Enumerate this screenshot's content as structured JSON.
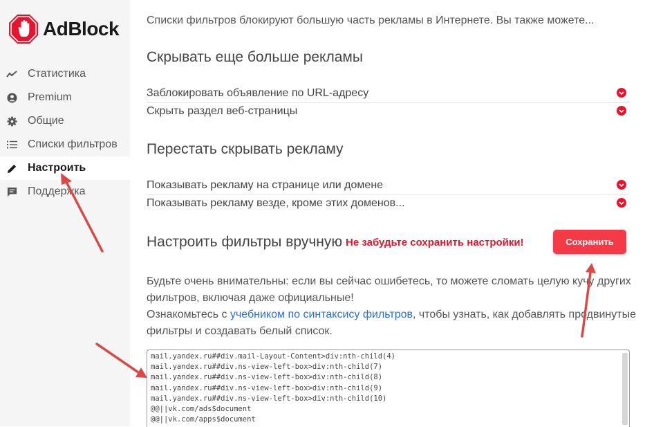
{
  "app": {
    "name": "AdBlock"
  },
  "sidebar": {
    "items": [
      {
        "label": "Статистика",
        "icon": "trend-line-icon",
        "active": false
      },
      {
        "label": "Premium",
        "icon": "user-circle-icon",
        "active": false
      },
      {
        "label": "Общие",
        "icon": "gear-icon",
        "active": false
      },
      {
        "label": "Списки фильтров",
        "icon": "list-icon",
        "active": false
      },
      {
        "label": "Настроить",
        "icon": "pencil-icon",
        "active": true
      },
      {
        "label": "Поддержка",
        "icon": "chat-icon",
        "active": false
      }
    ]
  },
  "main": {
    "intro": "Списки фильтров блокируют большую часть рекламы в Интернете. Вы также можете...",
    "section_hide": {
      "title": "Скрывать еще больше рекламы",
      "rows": [
        "Заблокировать объявление по URL-адресу",
        "Скрыть раздел веб-страницы"
      ]
    },
    "section_show": {
      "title": "Перестать скрывать рекламу",
      "rows": [
        "Показывать рекламу на странице или домене",
        "Показывать рекламу везде, кроме этих доменов..."
      ]
    },
    "manual": {
      "title": "Настроить фильтры вручную",
      "warning": "Не забудьте сохранить настройки!",
      "save_label": "Сохранить",
      "para1_line1": "Будьте очень внимательны: если вы сейчас ошибетесь, то можете сломать целую кучу других",
      "para1_line2": "фильтров, включая даже официальные!",
      "para2_prefix": "Ознакомьтесь с ",
      "para2_link": "учебником по синтаксису фильтров",
      "para2_suffix": ", чтобы узнать, как добавлять продвинутые",
      "para2_line2": "фильтры и создавать белый список.",
      "filters": [
        "mail.yandex.ru##div.mail-Layout-Content>div:nth-child(4)",
        "mail.yandex.ru##div.ns-view-left-box>div:nth-child(7)",
        "mail.yandex.ru##div.ns-view-left-box>div:nth-child(8)",
        "mail.yandex.ru##div.ns-view-left-box>div:nth-child(9)",
        "mail.yandex.ru##div.ns-view-left-box>div:nth-child(10)",
        "@@||vk.com/ads$document",
        "@@||vk.com/apps$document"
      ]
    }
  },
  "colors": {
    "accent": "#e8142d",
    "button": "#f43a46",
    "link": "#2a6fd6",
    "arrow": "#d94a46"
  }
}
